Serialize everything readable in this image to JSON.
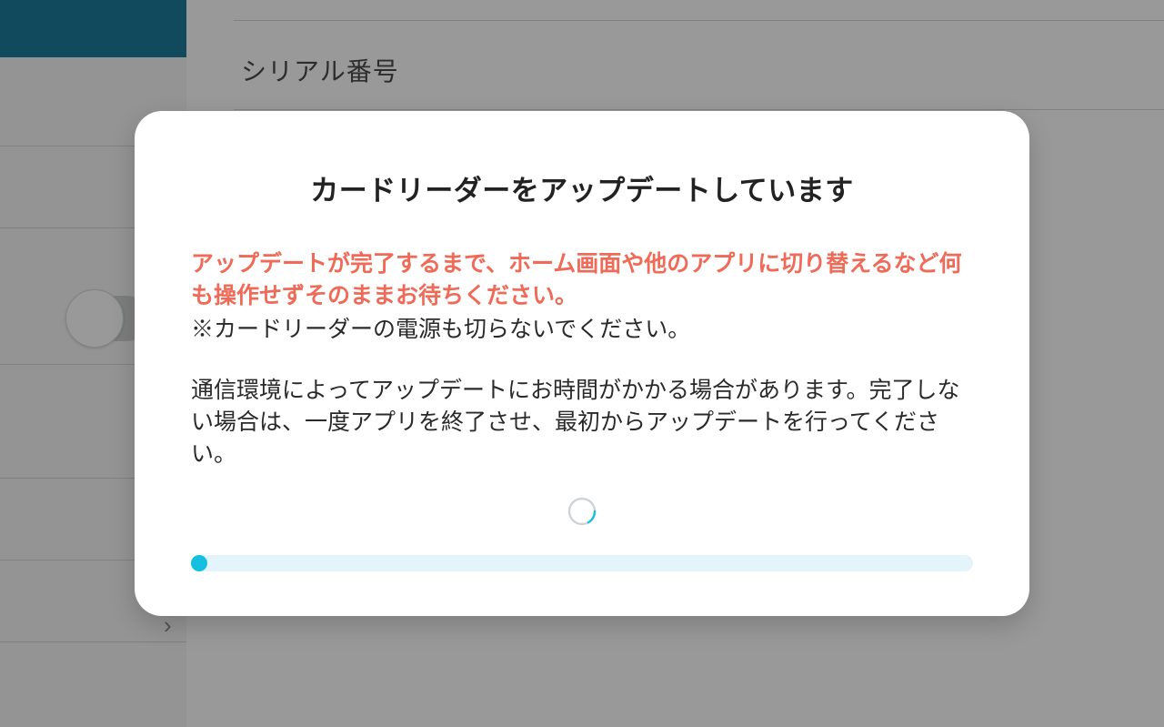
{
  "background": {
    "serial_label": "シリアル番号"
  },
  "modal": {
    "title": "カードリーダーをアップデートしています",
    "warning": "アップデートが完了するまで、ホーム画面や他のアプリに切り替えるなど何も操作せずそのままお待ちください。",
    "note": "※カードリーダーの電源も切らないでください。",
    "paragraph": "通信環境によってアップデートにお時間がかかる場合があります。完了しない場合は、一度アプリを終了させ、最初からアップデートを行ってください。",
    "progress_percent": 1
  },
  "colors": {
    "accent": "#14bfe0",
    "warning_text": "#ef6a57",
    "sidebar_active": "#1b7c99"
  }
}
